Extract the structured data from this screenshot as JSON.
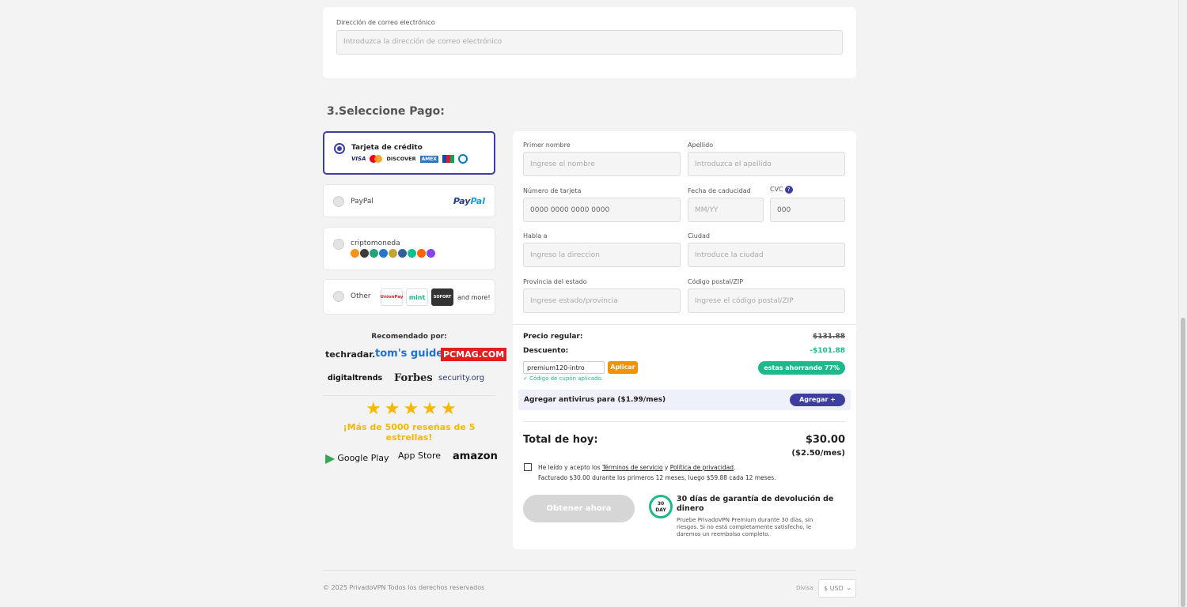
{
  "email": {
    "label": "Dirección de correo electrónico",
    "placeholder": "Introduzca la dirección de correo electrónico"
  },
  "payment": {
    "section_title": "3.Seleccione Pago:",
    "options": [
      {
        "label": "Tarjeta de crédito",
        "selected": true,
        "logos": [
          "VISA",
          "mastercard",
          "DISCOVER",
          "AMEX",
          "JCB",
          "Diners Club"
        ]
      },
      {
        "label": "PayPal",
        "selected": false,
        "logo_a": "Pay",
        "logo_b": "Pal"
      },
      {
        "label": "criptomoneda",
        "selected": false,
        "coins": [
          "bitcoin",
          "ethereum",
          "tether",
          "usd-coin",
          "dogecoin",
          "litecoin",
          "bitcoin-cash",
          "monero",
          "polygon"
        ]
      },
      {
        "label": "Other",
        "selected": false,
        "logos": [
          "UnionPay",
          "mint",
          "SOFORT"
        ],
        "more": "and more!"
      }
    ]
  },
  "recommended": {
    "title": "Recomendado por:",
    "press": [
      "techradar.",
      "tom's guide",
      "PCMAG.COM",
      "digitaltrends",
      "Forbes",
      "security.org"
    ],
    "stars": 5,
    "reviews_text": "¡Más de 5000 reseñas de 5 estrellas!",
    "stores": [
      "Google Play",
      "App Store",
      "amazon"
    ]
  },
  "form": {
    "first_name": {
      "label": "Primer nombre",
      "placeholder": "Ingrese el nombre"
    },
    "last_name": {
      "label": "Apellido",
      "placeholder": "Introduzca el apellido"
    },
    "card_number": {
      "label": "Número de tarjeta",
      "placeholder": "0000 0000 0000 0000"
    },
    "expiry": {
      "label": "Fecha de caducidad",
      "placeholder": "MM/YY"
    },
    "cvc": {
      "label": "CVC",
      "placeholder": "000",
      "help": "?"
    },
    "address": {
      "label": "Habla a",
      "placeholder": "Ingreso la direccion"
    },
    "city": {
      "label": "Ciudad",
      "placeholder": "Introduce la ciudad"
    },
    "state": {
      "label": "Provincia del estado",
      "placeholder": "Ingrese estado/provincia"
    },
    "zip": {
      "label": "Código postal/ZIP",
      "placeholder": "Ingrese el código postal/ZIP"
    }
  },
  "pricing": {
    "regular_label": "Precio regular:",
    "regular_value": "$131.88",
    "discount_label": "Descuento:",
    "discount_value": "-$101.88",
    "coupon_value": "premium120-intro",
    "apply_label": "Aplicar",
    "saving_badge": "estas ahorrando 77%",
    "coupon_ok": "✓ Código de cupón aplicado.",
    "antivirus_label": "Agregar antivirus para ($1.99/mes)",
    "antivirus_button": "Agregar +",
    "total_label": "Total de hoy:",
    "total_value": "$30.00",
    "total_monthly": "($2.50/mes)"
  },
  "terms": {
    "prefix": "He leído y acepto los ",
    "tos": "Términos de servicio",
    "and": " y ",
    "privacy": "Política de privacidad",
    "suffix": ".",
    "billing": "Facturado $30.00 durante los primeros 12 meses, luego $59.88 cada 12 meses."
  },
  "cta_label": "Obtener ahora",
  "guarantee": {
    "badge_num": "30",
    "badge_txt": "DAY",
    "title": "30 días de garantía de devolución de dinero",
    "desc": "Pruebe PrivadoVPN Premium durante 30 días, sin riesgos. Si no está completamente satisfecho, le daremos un reembolso completo."
  },
  "footer": {
    "copyright": "© 2025 PrivadoVPN Todos los derechos reservados",
    "currency_label": "Divisa:",
    "currency_value": "$ USD"
  },
  "colors": {
    "accent": "#3d3e9e",
    "green": "#1db98c",
    "orange": "#f39200",
    "star": "#f5b800"
  }
}
